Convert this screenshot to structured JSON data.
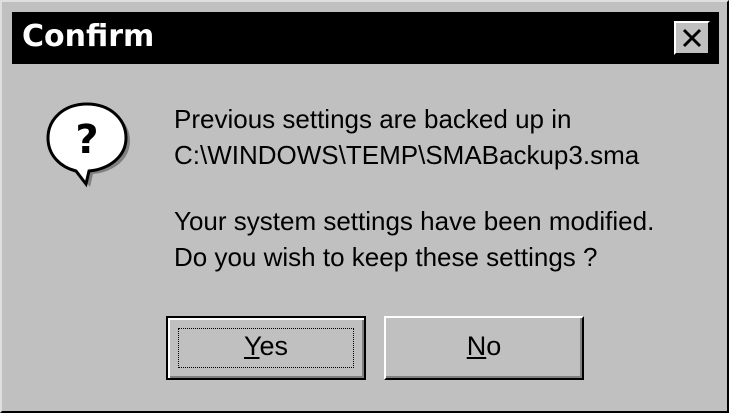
{
  "window": {
    "title": "Confirm",
    "close_icon": "close-icon"
  },
  "icon": {
    "name": "question-icon",
    "glyph": "?"
  },
  "message": {
    "line1": "Previous settings are backed up in",
    "line2": "C:\\WINDOWS\\TEMP\\SMABackup3.sma",
    "line3": "Your system settings have been modified.",
    "line4": "Do you wish to keep these settings ?"
  },
  "buttons": {
    "yes": {
      "accel": "Y",
      "rest": "es"
    },
    "no": {
      "accel": "N",
      "rest": "o"
    }
  },
  "colors": {
    "face": "#c0c0c0",
    "titlebar": "#000000",
    "title_text": "#ffffff"
  }
}
